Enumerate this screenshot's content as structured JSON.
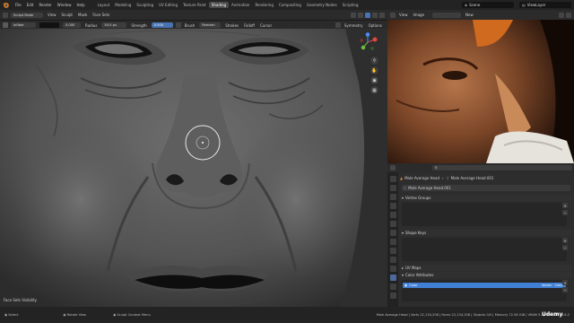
{
  "app": {
    "menus": [
      "File",
      "Edit",
      "Render",
      "Window",
      "Help"
    ],
    "workspace_tabs": [
      "Layout",
      "Modeling",
      "Sculpting",
      "UV Editing",
      "Texture Paint",
      "Shading",
      "Animation",
      "Rendering",
      "Compositing",
      "Geometry Nodes",
      "Scripting"
    ],
    "active_workspace": "Shading",
    "scene_name": "Scene",
    "view_layer_name": "ViewLayer"
  },
  "viewport_header": {
    "mode": "Sculpt Mode",
    "menus": [
      "View",
      "Sculpt",
      "Mask",
      "Face Sets"
    ],
    "brush_label": "Brush",
    "radius_label": "Radius",
    "radius_value": "50.0 px",
    "strength_label": "Strength",
    "strength_value": "0.500",
    "mode_field": "Remesh",
    "strokes_label": "Strokes",
    "falloff_label": "Falloff",
    "cursor_label": "Cursor",
    "symmetry_label": "Symmetry",
    "options_label": "Options",
    "brush_name": "Inflate",
    "brush_value": "0.000",
    "value_blue": "0.500"
  },
  "viewport": {
    "bottom_left_label": "Face Sets Visibility"
  },
  "image_editor": {
    "menus": [
      "View",
      "Image"
    ],
    "new_label": "New"
  },
  "outliner": {
    "search_placeholder": ""
  },
  "properties": {
    "object_name": "Male Average Head",
    "mesh_name": "Male Average Head.001",
    "data_name_row": "Male Average Head.001",
    "vertex_groups_title": "Vertex Groups",
    "shape_keys_title": "Shape Keys",
    "uv_maps_title": "UV Maps",
    "color_attributes_title": "Color Attributes",
    "color_attribute_item": "Color",
    "color_attribute_meta": "Vertex · Color"
  },
  "status_bar": {
    "items": [
      "Select",
      "Rotate View",
      "Sculpt Context Menu"
    ],
    "stats": "Male Average Head | Verts 22,134,206 | Faces 22,134,208 | Objects 0/0 | Memory 72.56 GiB | VRAM 5.4/24.0 GiB | 3.6.2",
    "watermark": "Udemy"
  },
  "colors": {
    "accent_blue": "#4772b3",
    "selection_blue": "#3f7fd4",
    "panel_bg": "#2d2d2d",
    "header_bg": "#2b2b2b"
  }
}
